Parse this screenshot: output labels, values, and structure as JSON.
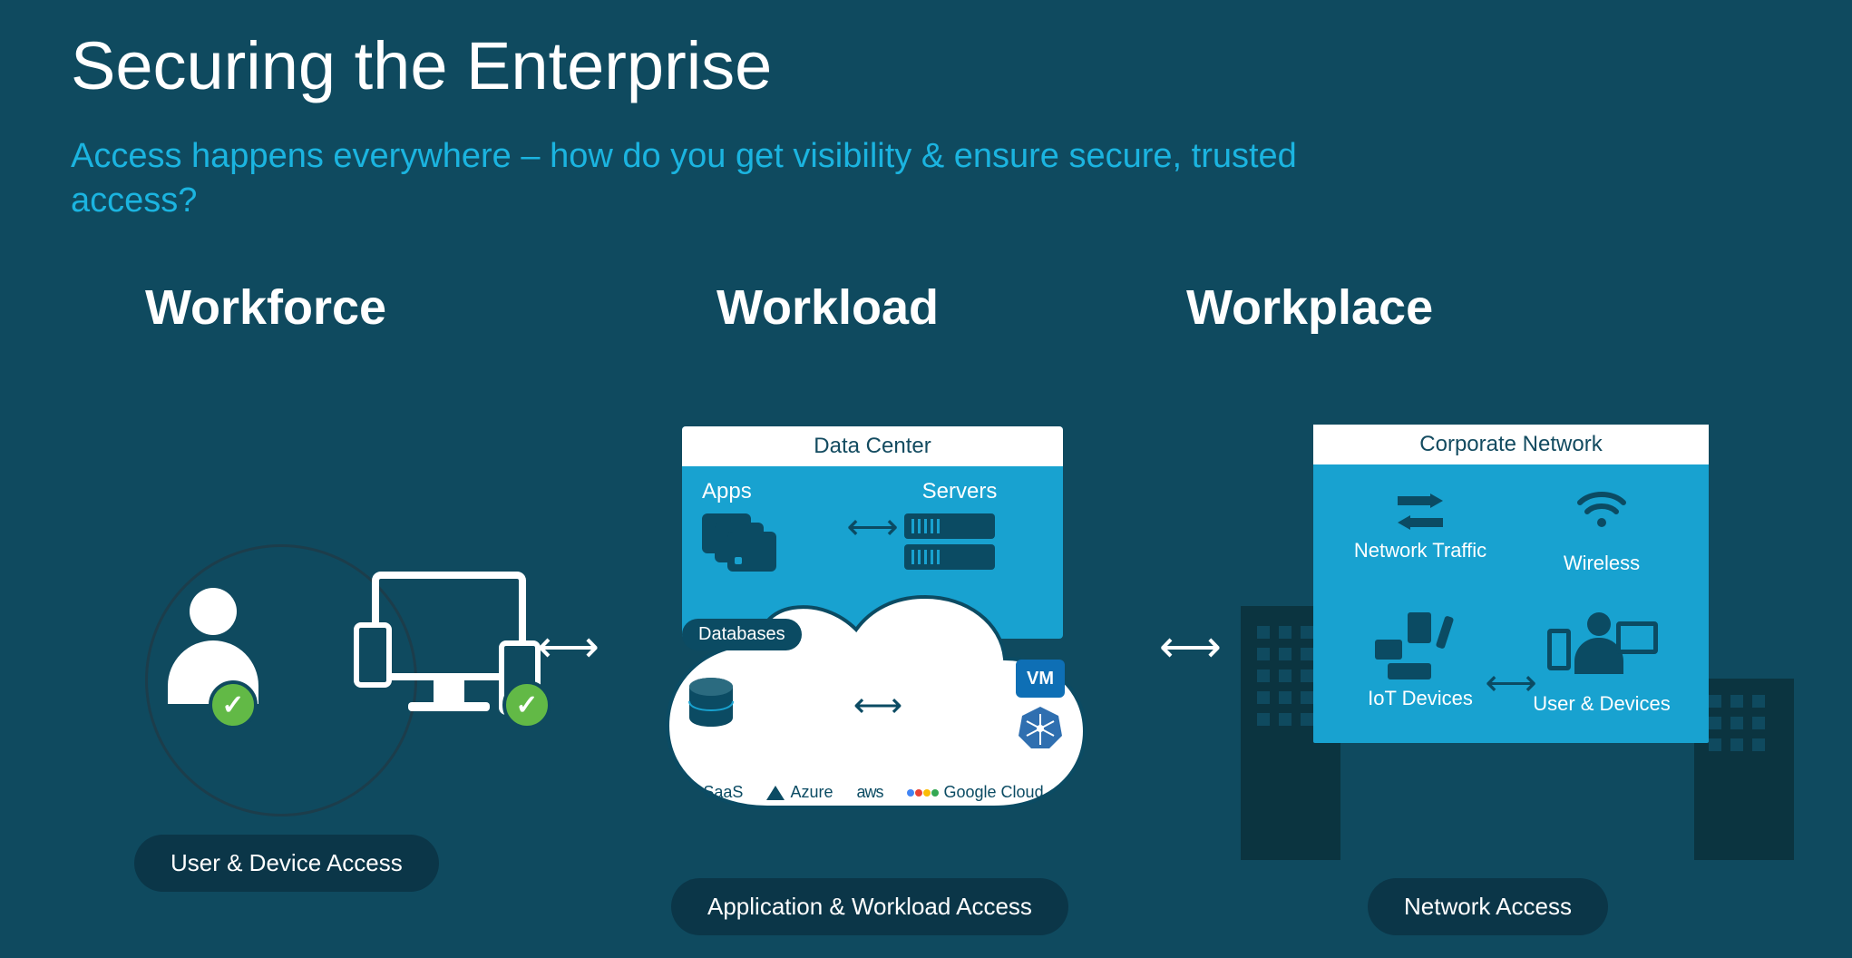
{
  "title": "Securing the Enterprise",
  "subtitle": "Access happens everywhere – how do you get visibility & ensure secure, trusted access?",
  "columns": {
    "workforce": {
      "heading": "Workforce",
      "caption": "User & Device Access"
    },
    "workload": {
      "heading": "Workload",
      "caption": "Application & Workload Access",
      "datacenter": {
        "title": "Data Center",
        "left_label": "Apps",
        "right_label": "Servers"
      },
      "cloud": {
        "databases_label": "Databases",
        "vm_label": "VM",
        "providers": {
          "saas": "SaaS",
          "azure": "Azure",
          "aws": "aws",
          "google": "Google Cloud"
        }
      }
    },
    "workplace": {
      "heading": "Workplace",
      "caption": "Network Access",
      "corporate_network": {
        "title": "Corporate Network",
        "items": {
          "network_traffic": "Network Traffic",
          "wireless": "Wireless",
          "iot_devices": "IoT Devices",
          "user_devices": "User & Devices"
        }
      }
    }
  }
}
